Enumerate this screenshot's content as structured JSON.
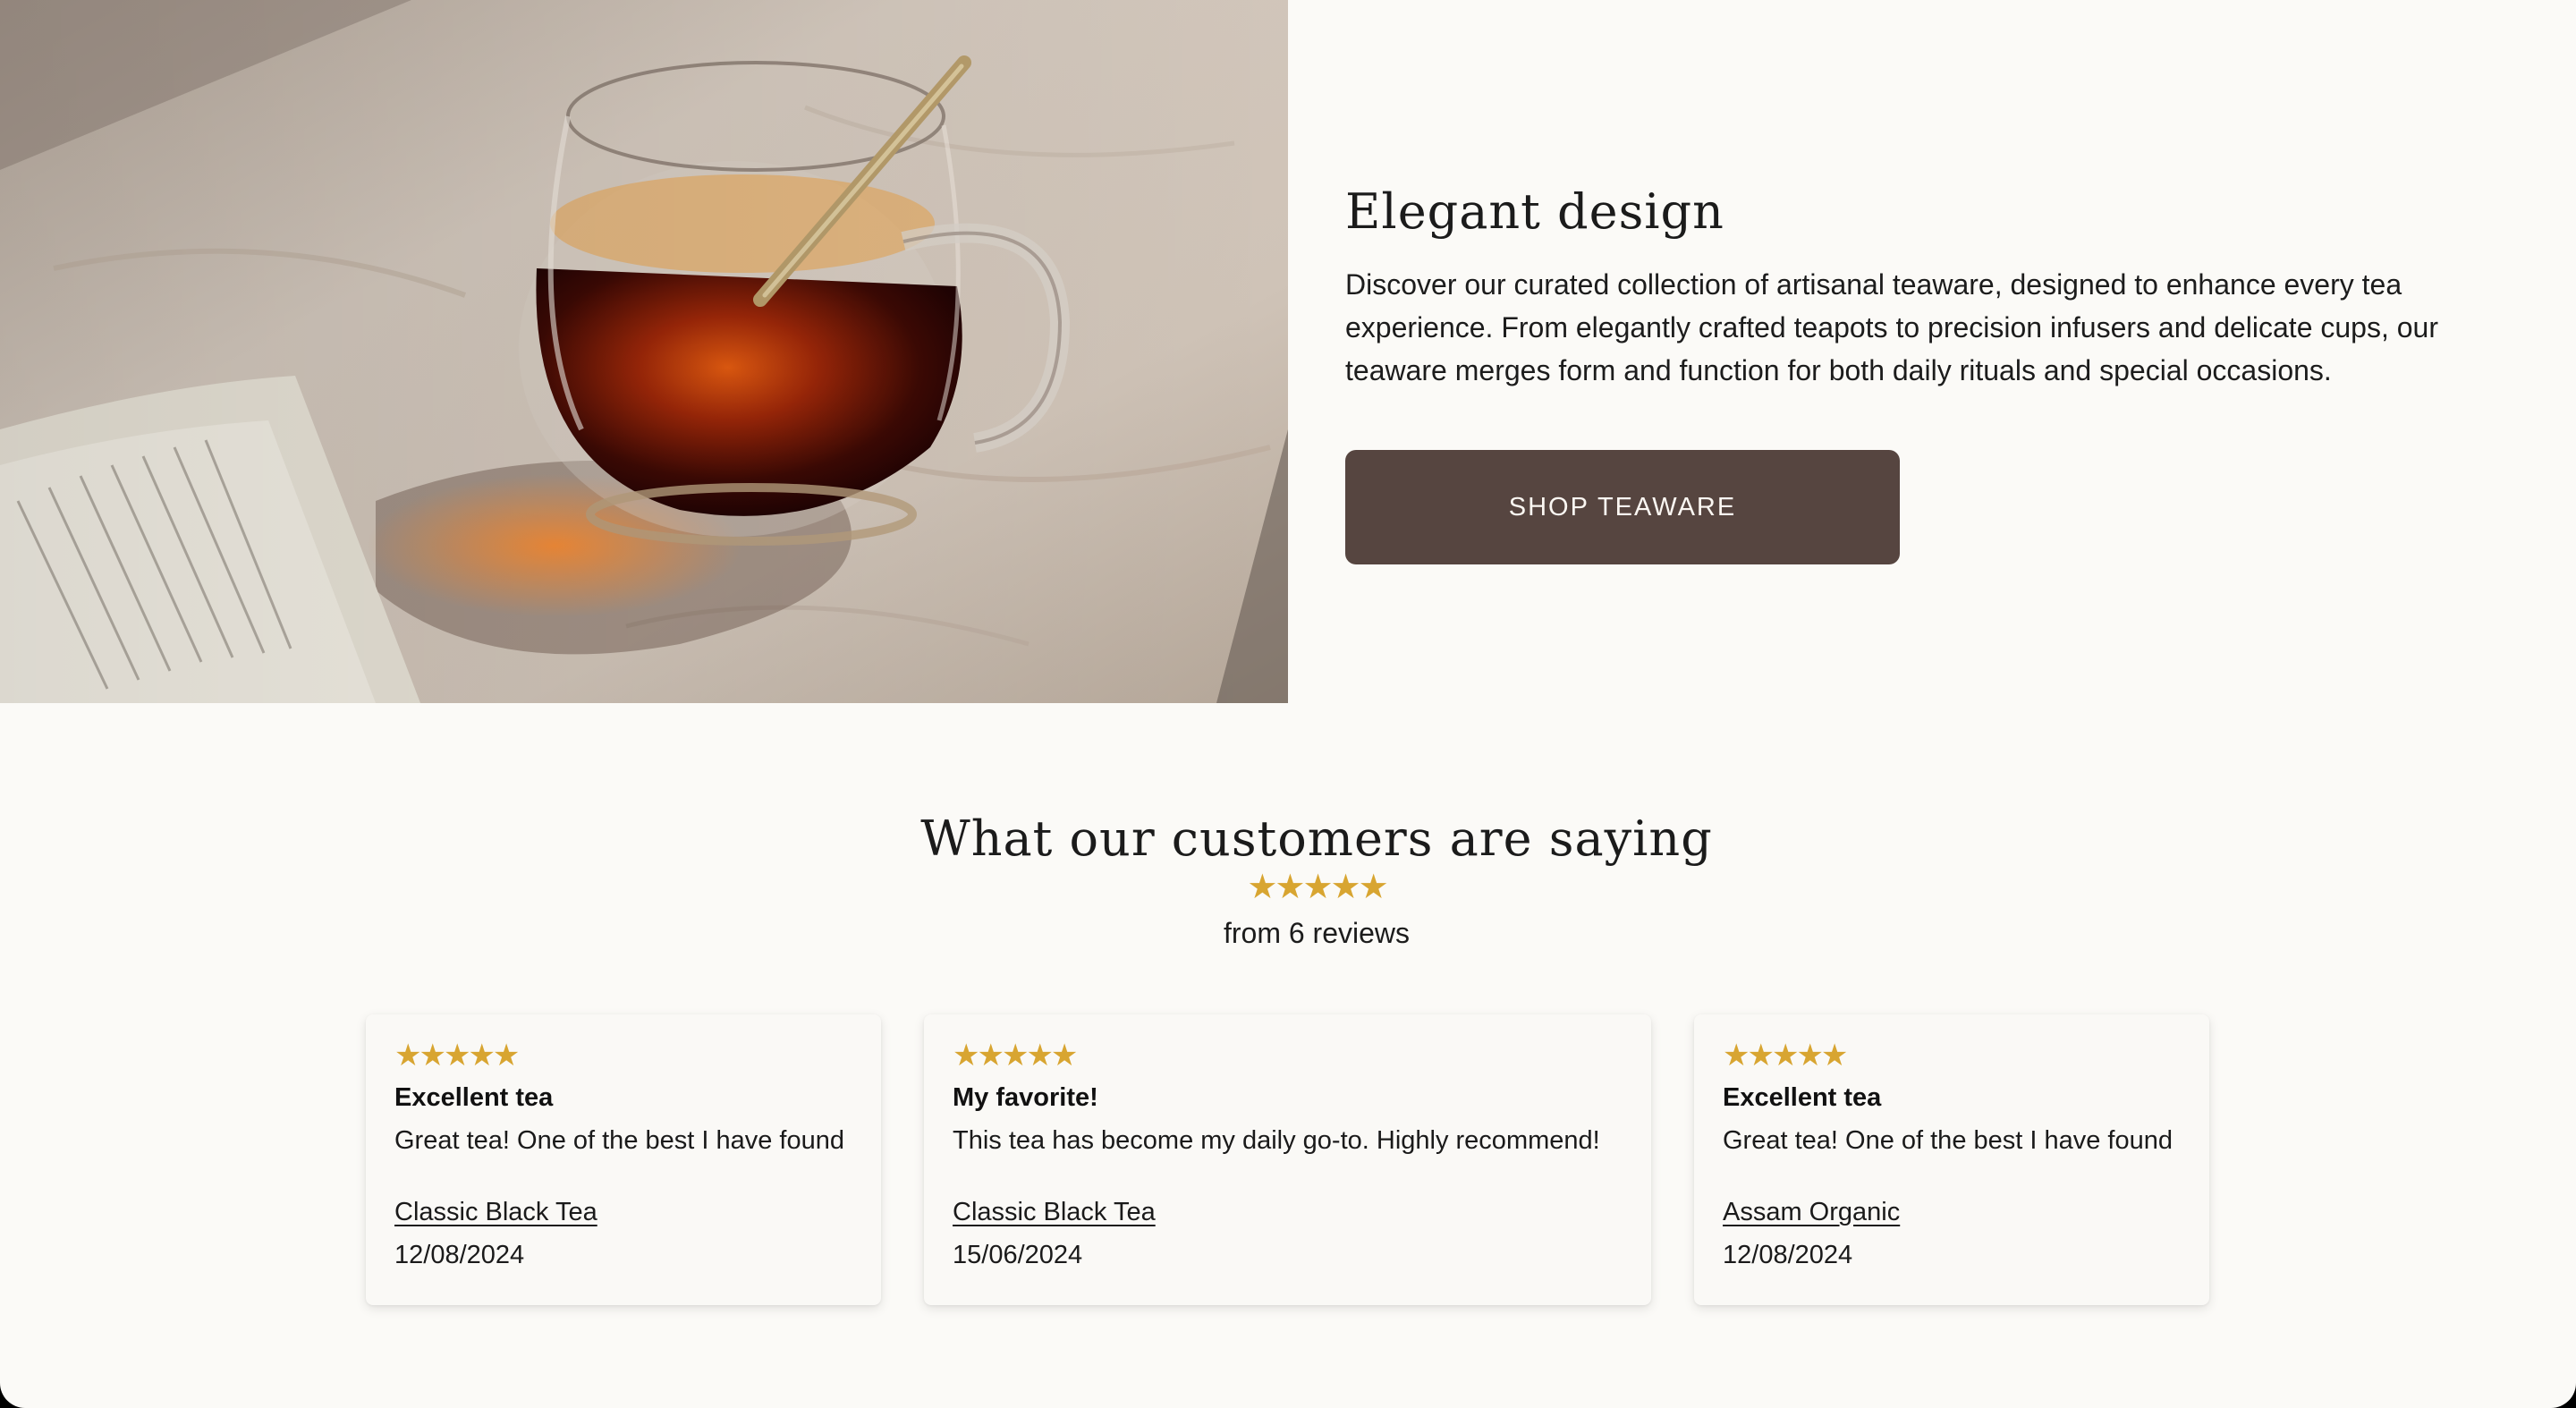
{
  "hero": {
    "title": "Elegant design",
    "body": "Discover our curated collection of artisanal teaware, designed to enhance every tea experience. From elegantly crafted teapots to precision infusers and delicate cups, our teaware merges form and function for both daily rituals and special occasions.",
    "button_label": "SHOP TEAWARE",
    "image_subject": "glass-tea-cup-photo"
  },
  "reviews": {
    "title": "What our customers are saying",
    "stars": "★★★★★",
    "rating_out_of_5": 5,
    "count_text": "from 6 reviews",
    "items": [
      {
        "stars": "★★★★★",
        "rating": 5,
        "title": "Excellent tea",
        "text": "Great tea! One of the best I have found",
        "product": "Classic Black Tea",
        "date": "12/08/2024"
      },
      {
        "stars": "★★★★★",
        "rating": 5,
        "title": "My favorite!",
        "text": "This tea has become my daily go-to. Highly recommend!",
        "product": "Classic Black Tea",
        "date": "15/06/2024"
      },
      {
        "stars": "★★★★★",
        "rating": 5,
        "title": "Excellent tea",
        "text": "Great tea! One of the best I have found",
        "product": "Assam Organic",
        "date": "12/08/2024"
      }
    ]
  },
  "colors": {
    "page_background": "#fbfaf7",
    "button_background": "#564540",
    "button_text": "#fbf7f2",
    "star_gold": "#d8a531",
    "text_dark": "#1a1a1a"
  }
}
